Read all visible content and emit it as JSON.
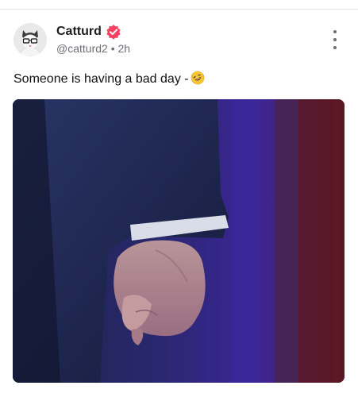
{
  "post": {
    "author_name": "Catturd",
    "handle": "@catturd2",
    "separator": "•",
    "time": "2h",
    "text": "Someone is having a bad day -",
    "emoji": "rolling-on-floor-laughing",
    "image_subject": "suit-sleeve-clenched-fist"
  },
  "icons": {
    "verified": "verified-badge-icon",
    "more": "more-vertical-icon"
  },
  "colors": {
    "verified_badge": "#f5415f",
    "text_primary": "#111111",
    "text_secondary": "#6b6f76"
  }
}
